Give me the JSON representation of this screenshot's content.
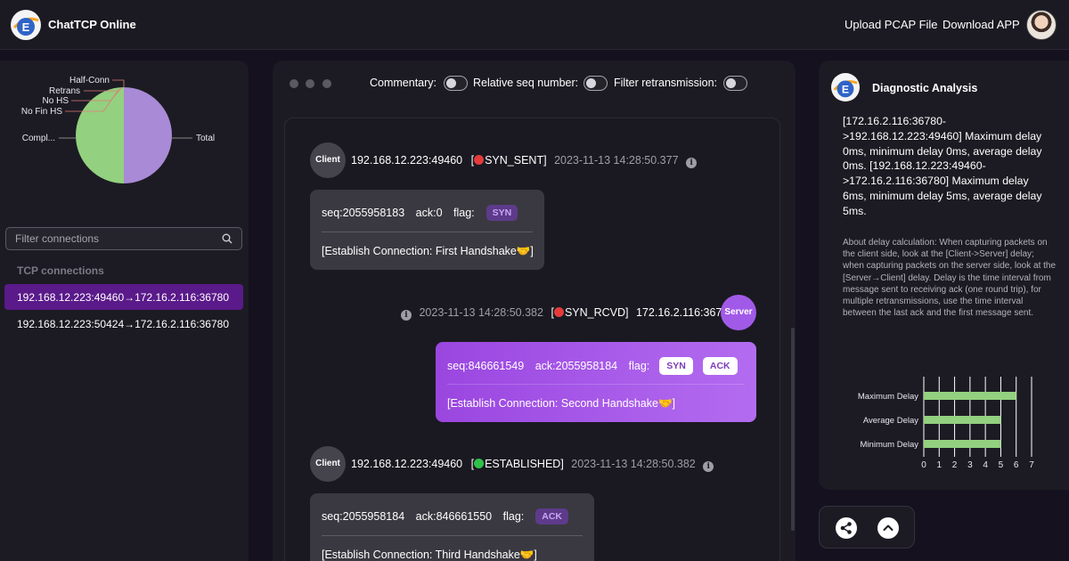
{
  "header": {
    "app_title": "ChatTCP Online",
    "upload_label": "Upload PCAP File",
    "download_label": "Download APP"
  },
  "left": {
    "pie": {
      "labels": [
        "Half-Conn",
        "Retrans",
        "No HS",
        "No Fin HS",
        "Compl...",
        "Total"
      ],
      "colors": {
        "completed": "#93d07f",
        "total": "#a98ad6"
      }
    },
    "filter_placeholder": "Filter connections",
    "section_label": "TCP connections",
    "connections": [
      "192.168.12.223:49460→172.16.2.116:36780",
      "192.168.12.223:50424→172.16.2.116:36780"
    ]
  },
  "toolbar": {
    "commentary": "Commentary:",
    "relative_seq": "Relative seq number:",
    "filter_retrans": "Filter retransmission:"
  },
  "messages": [
    {
      "role": "Client",
      "addr": "192.168.12.223:49460",
      "state": "SYN_SENT",
      "state_color": "#e33b3b",
      "time": "2023-11-13 14:28:50.377",
      "seq": "seq:2055958183",
      "ack": "ack:0",
      "flag": "flag:",
      "badges": [
        "SYN"
      ],
      "desc": "[Establish Connection: First Handshake🤝]"
    },
    {
      "role": "Server",
      "addr": "172.16.2.116:36780",
      "state": "SYN_RCVD",
      "state_color": "#e33b3b",
      "time": "2023-11-13 14:28:50.382",
      "seq": "seq:846661549",
      "ack": "ack:2055958184",
      "flag": "flag:",
      "badges": [
        "SYN",
        "ACK"
      ],
      "desc": "[Establish Connection: Second Handshake🤝]"
    },
    {
      "role": "Client",
      "addr": "192.168.12.223:49460",
      "state": "ESTABLISHED",
      "state_color": "#2ec24a",
      "time": "2023-11-13 14:28:50.382",
      "seq": "seq:2055958184",
      "ack": "ack:846661550",
      "flag": "flag:",
      "badges": [
        "ACK"
      ],
      "desc": "[Establish Connection: Third Handshake🤝]"
    }
  ],
  "diagnostic": {
    "title": "Diagnostic Analysis",
    "text": "[172.16.2.116:36780->192.168.12.223:49460] Maximum delay 0ms, minimum delay 0ms, average delay 0ms. [192.168.12.223:49460->172.16.2.116:36780] Maximum delay 6ms, minimum delay 5ms, average delay 5ms.",
    "note": "About delay calculation: When capturing packets on the client side, look at the [Client->Server] delay; when capturing packets on the server side, look at the [Server→Client] delay. Delay is the time interval from message sent to receiving ack (one round trip), for multiple retransmissions, use the time interval between the last ack and the first message sent."
  },
  "chart_data": {
    "type": "bar",
    "orientation": "horizontal",
    "categories": [
      "Maximum Delay",
      "Average Delay",
      "Minimum Delay"
    ],
    "values": [
      6,
      5,
      5
    ],
    "xlim": [
      0,
      7
    ],
    "xticks": [
      "0",
      "1",
      "2",
      "3",
      "4",
      "5",
      "6",
      "7"
    ],
    "bar_color": "#93d07f",
    "grid": true
  }
}
